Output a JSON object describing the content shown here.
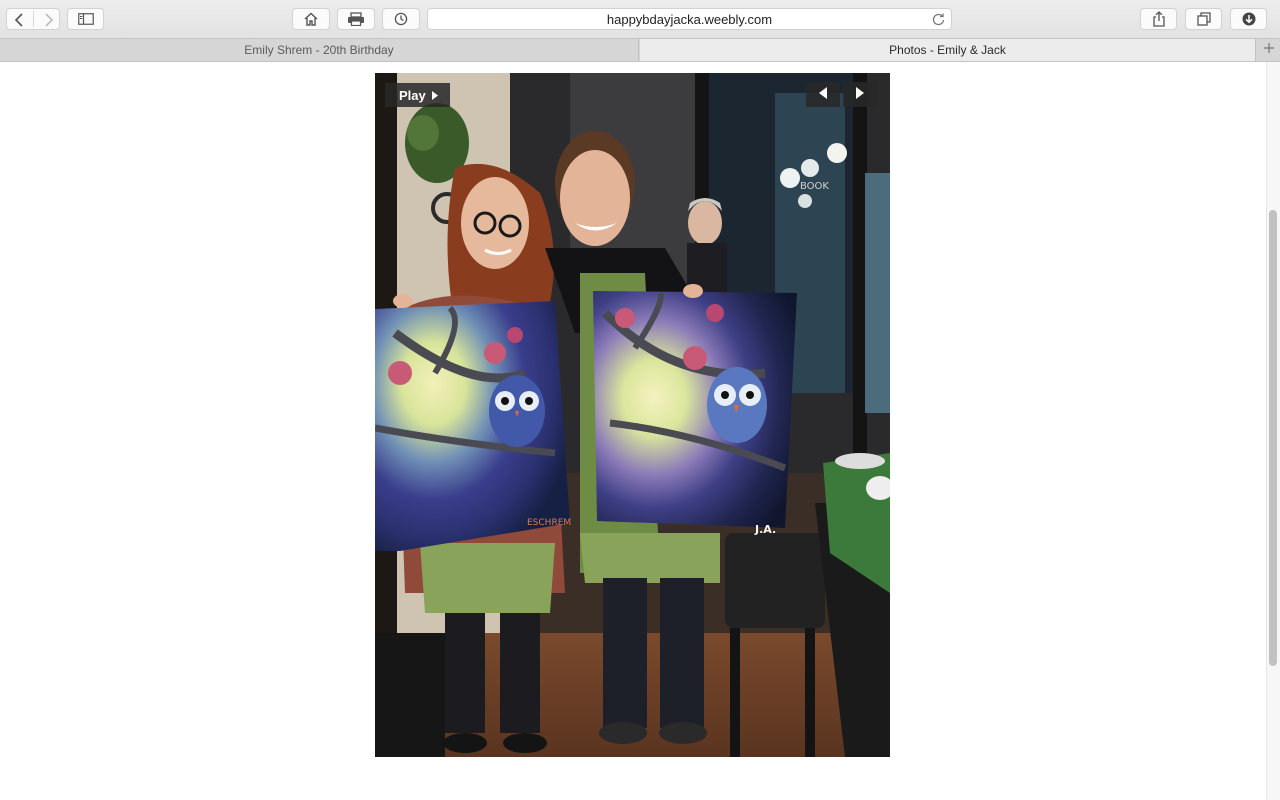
{
  "browser": {
    "url": "happybdayjacka.weebly.com",
    "tabs": [
      {
        "label": "Emily Shrem - 20th Birthday",
        "active": false
      },
      {
        "label": "Photos - Emily & Jack",
        "active": true
      }
    ],
    "toolbar_icons": [
      "back-icon",
      "forward-icon",
      "sidebar-icon",
      "home-icon",
      "print-icon",
      "history-icon",
      "reload-icon",
      "share-icon",
      "tabs-overview-icon",
      "downloads-icon",
      "new-tab-icon"
    ]
  },
  "slideshow": {
    "play_label": "Play",
    "canvas_labels": [
      "BOOK",
      "ESCHREM",
      "J.A."
    ],
    "colors": {
      "control_bg": "#282828",
      "control_text": "#ffffff"
    }
  }
}
